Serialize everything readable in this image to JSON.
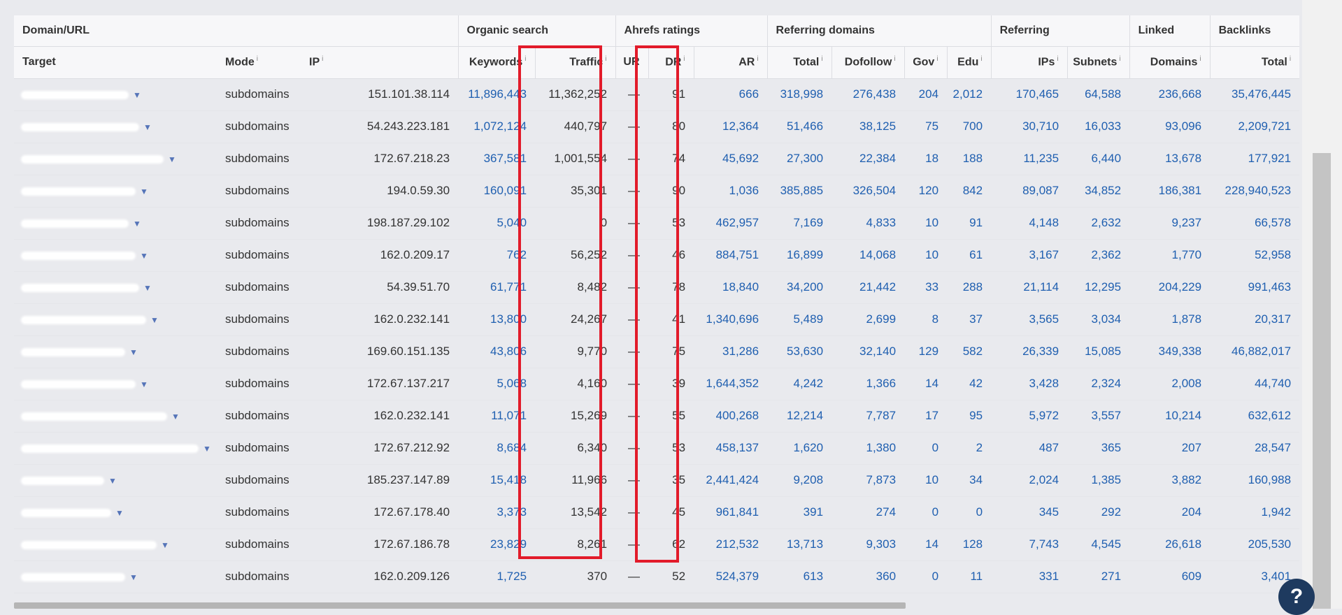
{
  "groups": [
    "Domain/URL",
    "Organic search",
    "Ahrefs ratings",
    "Referring domains",
    "Referring",
    "Linked",
    "Backlinks"
  ],
  "columns": [
    "Target",
    "Mode",
    "IP",
    "Keywords",
    "Traffic",
    "UR",
    "DR",
    "AR",
    "Total",
    "Dofollow",
    "Gov",
    "Edu",
    "IPs",
    "Subnets",
    "Domains",
    "Total"
  ],
  "info_glyph": "i",
  "dropdown_glyph": "▼",
  "help_glyph": "?",
  "rows": [
    {
      "mode": "subdomains",
      "ip": "151.101.38.114",
      "keywords": "11,896,443",
      "traffic": "11,362,252",
      "ur": "—",
      "dr": "91",
      "ar": "666",
      "total": "318,998",
      "dofollow": "276,438",
      "gov": "204",
      "edu": "2,012",
      "ips": "170,465",
      "subnets": "64,588",
      "domains": "236,668",
      "backlinks": "35,476,445"
    },
    {
      "mode": "subdomains",
      "ip": "54.243.223.181",
      "keywords": "1,072,124",
      "traffic": "440,797",
      "ur": "—",
      "dr": "80",
      "ar": "12,364",
      "total": "51,466",
      "dofollow": "38,125",
      "gov": "75",
      "edu": "700",
      "ips": "30,710",
      "subnets": "16,033",
      "domains": "93,096",
      "backlinks": "2,209,721"
    },
    {
      "mode": "subdomains",
      "ip": "172.67.218.23",
      "keywords": "367,581",
      "traffic": "1,001,554",
      "ur": "—",
      "dr": "74",
      "ar": "45,692",
      "total": "27,300",
      "dofollow": "22,384",
      "gov": "18",
      "edu": "188",
      "ips": "11,235",
      "subnets": "6,440",
      "domains": "13,678",
      "backlinks": "177,921"
    },
    {
      "mode": "subdomains",
      "ip": "194.0.59.30",
      "keywords": "160,091",
      "traffic": "35,301",
      "ur": "—",
      "dr": "90",
      "ar": "1,036",
      "total": "385,885",
      "dofollow": "326,504",
      "gov": "120",
      "edu": "842",
      "ips": "89,087",
      "subnets": "34,852",
      "domains": "186,381",
      "backlinks": "228,940,523"
    },
    {
      "mode": "subdomains",
      "ip": "198.187.29.102",
      "keywords": "5,040",
      "traffic": "0",
      "ur": "—",
      "dr": "53",
      "ar": "462,957",
      "total": "7,169",
      "dofollow": "4,833",
      "gov": "10",
      "edu": "91",
      "ips": "4,148",
      "subnets": "2,632",
      "domains": "9,237",
      "backlinks": "66,578"
    },
    {
      "mode": "subdomains",
      "ip": "162.0.209.17",
      "keywords": "762",
      "traffic": "56,252",
      "ur": "—",
      "dr": "46",
      "ar": "884,751",
      "total": "16,899",
      "dofollow": "14,068",
      "gov": "10",
      "edu": "61",
      "ips": "3,167",
      "subnets": "2,362",
      "domains": "1,770",
      "backlinks": "52,958"
    },
    {
      "mode": "subdomains",
      "ip": "54.39.51.70",
      "keywords": "61,771",
      "traffic": "8,482",
      "ur": "—",
      "dr": "78",
      "ar": "18,840",
      "total": "34,200",
      "dofollow": "21,442",
      "gov": "33",
      "edu": "288",
      "ips": "21,114",
      "subnets": "12,295",
      "domains": "204,229",
      "backlinks": "991,463"
    },
    {
      "mode": "subdomains",
      "ip": "162.0.232.141",
      "keywords": "13,800",
      "traffic": "24,267",
      "ur": "—",
      "dr": "41",
      "ar": "1,340,696",
      "total": "5,489",
      "dofollow": "2,699",
      "gov": "8",
      "edu": "37",
      "ips": "3,565",
      "subnets": "3,034",
      "domains": "1,878",
      "backlinks": "20,317"
    },
    {
      "mode": "subdomains",
      "ip": "169.60.151.135",
      "keywords": "43,806",
      "traffic": "9,770",
      "ur": "—",
      "dr": "75",
      "ar": "31,286",
      "total": "53,630",
      "dofollow": "32,140",
      "gov": "129",
      "edu": "582",
      "ips": "26,339",
      "subnets": "15,085",
      "domains": "349,338",
      "backlinks": "46,882,017"
    },
    {
      "mode": "subdomains",
      "ip": "172.67.137.217",
      "keywords": "5,068",
      "traffic": "4,160",
      "ur": "—",
      "dr": "39",
      "ar": "1,644,352",
      "total": "4,242",
      "dofollow": "1,366",
      "gov": "14",
      "edu": "42",
      "ips": "3,428",
      "subnets": "2,324",
      "domains": "2,008",
      "backlinks": "44,740"
    },
    {
      "mode": "subdomains",
      "ip": "162.0.232.141",
      "keywords": "11,071",
      "traffic": "15,269",
      "ur": "—",
      "dr": "55",
      "ar": "400,268",
      "total": "12,214",
      "dofollow": "7,787",
      "gov": "17",
      "edu": "95",
      "ips": "5,972",
      "subnets": "3,557",
      "domains": "10,214",
      "backlinks": "632,612"
    },
    {
      "mode": "subdomains",
      "ip": "172.67.212.92",
      "keywords": "8,684",
      "traffic": "6,340",
      "ur": "—",
      "dr": "53",
      "ar": "458,137",
      "total": "1,620",
      "dofollow": "1,380",
      "gov": "0",
      "edu": "2",
      "ips": "487",
      "subnets": "365",
      "domains": "207",
      "backlinks": "28,547"
    },
    {
      "mode": "subdomains",
      "ip": "185.237.147.89",
      "keywords": "15,418",
      "traffic": "11,966",
      "ur": "—",
      "dr": "35",
      "ar": "2,441,424",
      "total": "9,208",
      "dofollow": "7,873",
      "gov": "10",
      "edu": "34",
      "ips": "2,024",
      "subnets": "1,385",
      "domains": "3,882",
      "backlinks": "160,988"
    },
    {
      "mode": "subdomains",
      "ip": "172.67.178.40",
      "keywords": "3,373",
      "traffic": "13,542",
      "ur": "—",
      "dr": "45",
      "ar": "961,841",
      "total": "391",
      "dofollow": "274",
      "gov": "0",
      "edu": "0",
      "ips": "345",
      "subnets": "292",
      "domains": "204",
      "backlinks": "1,942"
    },
    {
      "mode": "subdomains",
      "ip": "172.67.186.78",
      "keywords": "23,829",
      "traffic": "8,261",
      "ur": "—",
      "dr": "62",
      "ar": "212,532",
      "total": "13,713",
      "dofollow": "9,303",
      "gov": "14",
      "edu": "128",
      "ips": "7,743",
      "subnets": "4,545",
      "domains": "26,618",
      "backlinks": "205,530"
    },
    {
      "mode": "subdomains",
      "ip": "162.0.209.126",
      "keywords": "1,725",
      "traffic": "370",
      "ur": "—",
      "dr": "52",
      "ar": "524,379",
      "total": "613",
      "dofollow": "360",
      "gov": "0",
      "edu": "11",
      "ips": "331",
      "subnets": "271",
      "domains": "609",
      "backlinks": "3,401"
    }
  ]
}
